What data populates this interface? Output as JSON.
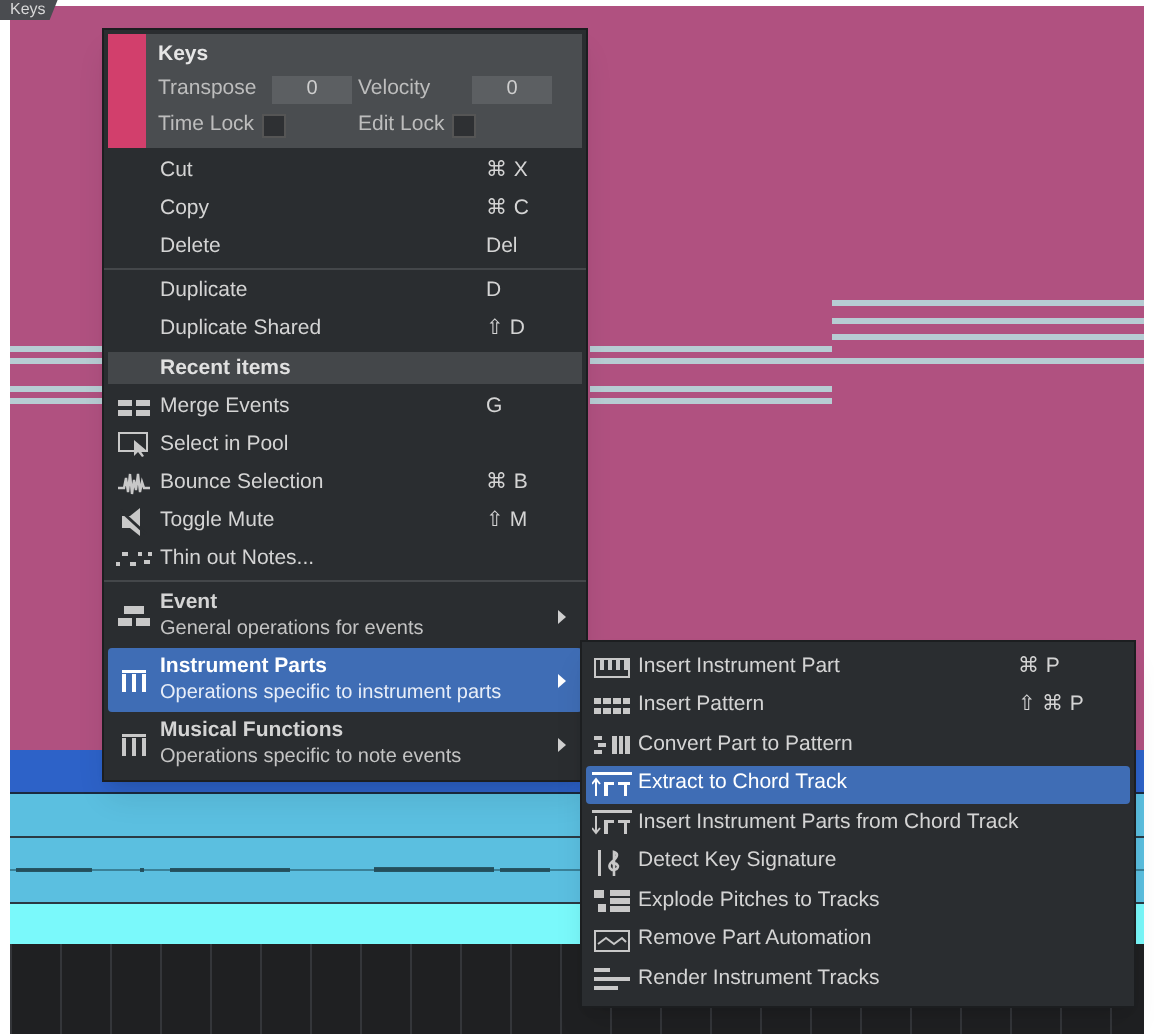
{
  "part": {
    "name": "Keys"
  },
  "menu": {
    "header": {
      "title": "Keys",
      "color": "#d23f6c",
      "fields": [
        {
          "label": "Transpose",
          "value": "0"
        },
        {
          "label": "Velocity",
          "value": "0"
        }
      ],
      "locks": [
        {
          "label": "Time Lock",
          "checked": false
        },
        {
          "label": "Edit Lock",
          "checked": false
        }
      ]
    },
    "sections": [
      {
        "items": [
          {
            "kind": "command",
            "label": "Cut",
            "shortcut": "⌘ X"
          },
          {
            "kind": "command",
            "label": "Copy",
            "shortcut": "⌘ C"
          },
          {
            "kind": "command",
            "label": "Delete",
            "shortcut": "Del"
          }
        ]
      },
      {
        "items": [
          {
            "kind": "command",
            "label": "Duplicate",
            "shortcut": "D"
          },
          {
            "kind": "command",
            "label": "Duplicate Shared",
            "shortcut": "⇧ D"
          }
        ]
      },
      {
        "heading": "Recent items",
        "items": [
          {
            "kind": "command",
            "label": "Merge Events",
            "shortcut": "G"
          },
          {
            "kind": "command",
            "label": "Select in Pool"
          },
          {
            "kind": "command",
            "label": "Bounce Selection",
            "shortcut": "⌘ B"
          },
          {
            "kind": "command",
            "label": "Toggle Mute",
            "shortcut": "⇧ M"
          },
          {
            "kind": "command",
            "label": "Thin out Notes..."
          }
        ]
      },
      {
        "items": [
          {
            "kind": "group",
            "label": "Event",
            "description": "General operations for events",
            "selected": false
          },
          {
            "kind": "group",
            "label": "Instrument Parts",
            "description": "Operations specific to instrument parts",
            "selected": true
          },
          {
            "kind": "group",
            "label": "Musical Functions",
            "description": "Operations specific to note events",
            "selected": false
          }
        ]
      }
    ]
  },
  "submenu": {
    "items": [
      {
        "label": "Insert Instrument Part",
        "shortcut": "⌘ P",
        "selected": false
      },
      {
        "label": "Insert Pattern",
        "shortcut": "⇧ ⌘ P",
        "selected": false
      },
      {
        "label": "Convert Part to Pattern",
        "selected": false
      },
      {
        "label": "Extract to Chord Track",
        "selected": true
      },
      {
        "label": "Insert Instrument Parts from Chord Track",
        "selected": false
      },
      {
        "label": "Detect Key Signature",
        "selected": false
      },
      {
        "label": "Explode Pitches to Tracks",
        "selected": false
      },
      {
        "label": "Remove Part Automation",
        "selected": false
      },
      {
        "label": "Render Instrument Tracks",
        "selected": false
      }
    ]
  }
}
